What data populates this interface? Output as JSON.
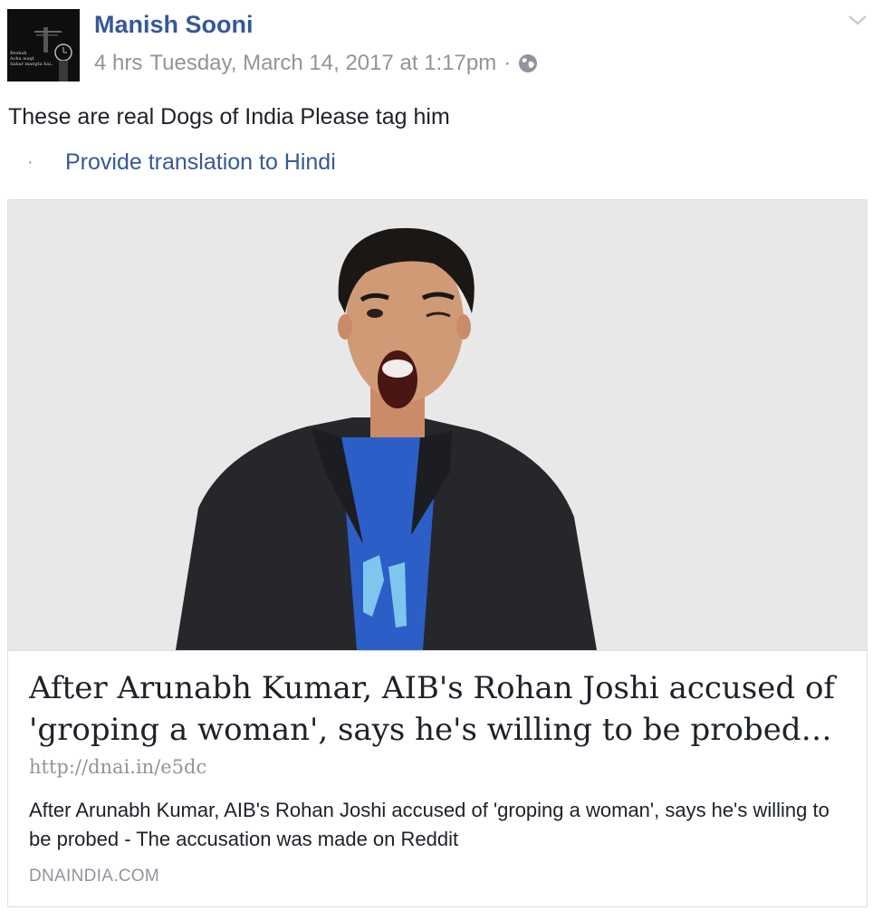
{
  "post": {
    "author": "Manish Sooni",
    "time_ago": "4 hrs",
    "timestamp": "Tuesday, March 14, 2017 at 1:17pm",
    "separator": "·",
    "privacy_icon": "globe-icon",
    "options_icon": "chevron-down-icon",
    "text": "These are real Dogs of India Please tag him",
    "translate_bullet": "·",
    "translate_link": "Provide translation to Hindi"
  },
  "avatar": {
    "caption_lines": "Beshak\nAcha waqt\nSabar mangta hai.."
  },
  "link_card": {
    "title": "After Arunabh Kumar, AIB's Rohan Joshi accused of 'groping a woman', says he's willing to be probed |...",
    "url": "http://dnai.in/e5dc",
    "description": "After Arunabh Kumar, AIB's Rohan Joshi accused of 'groping a woman', says he's willing to be probed - The accusation was made on Reddit",
    "domain": "DNAINDIA.COM"
  },
  "colors": {
    "author_link": "#365899",
    "meta_text": "#90949c",
    "body_text": "#1d2129",
    "card_border": "#dddfe2",
    "photo_background": "#e6e6e6",
    "jacket": "#25272b",
    "tshirt": "#2b5fc7"
  }
}
